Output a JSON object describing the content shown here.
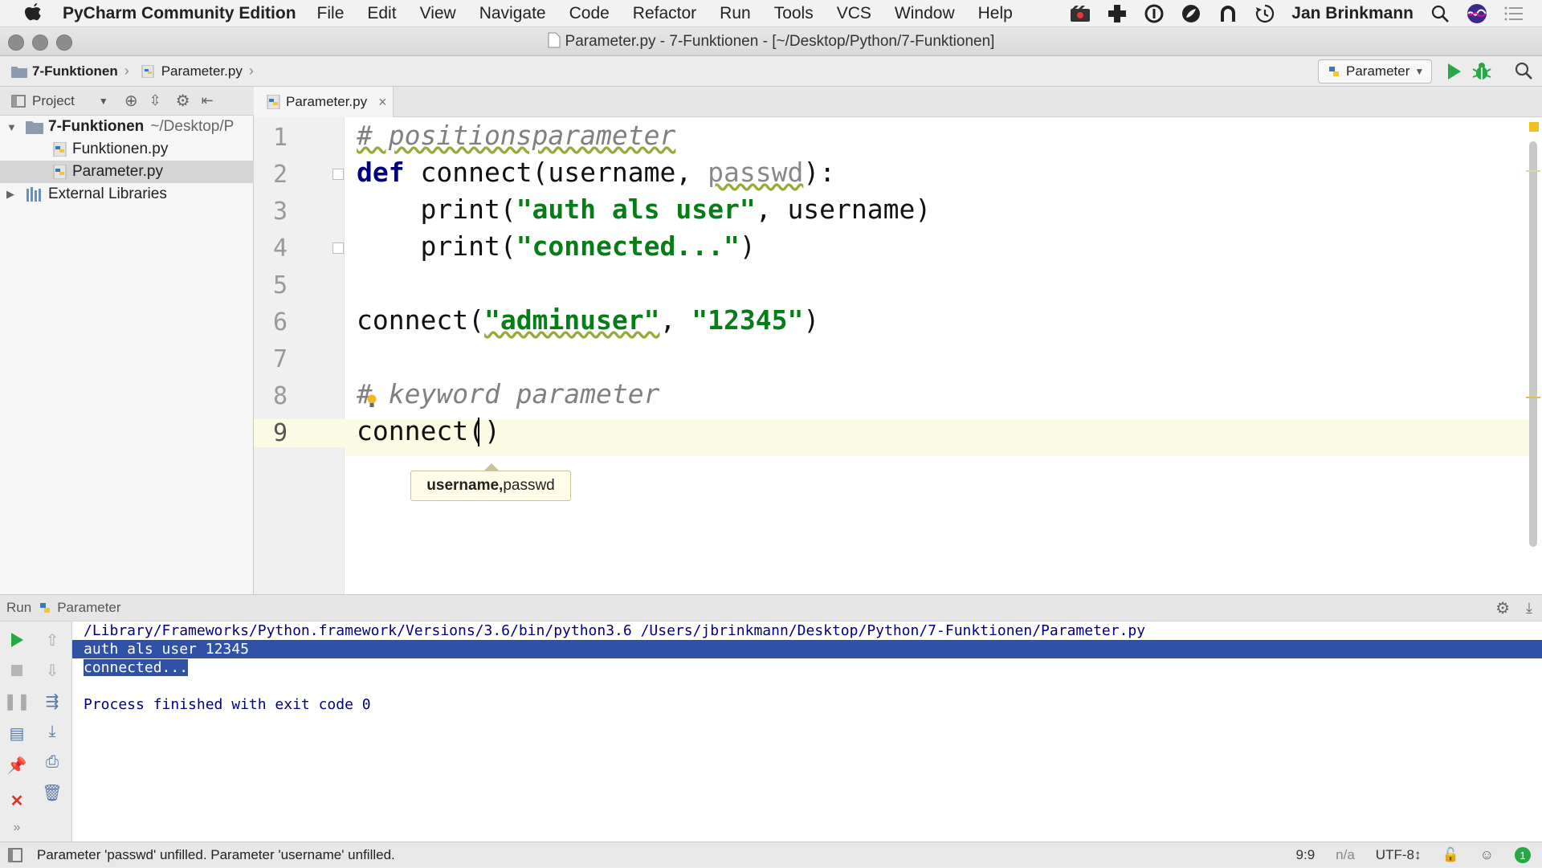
{
  "menubar": {
    "app_name": "PyCharm Community Edition",
    "items": [
      "File",
      "Edit",
      "View",
      "Navigate",
      "Code",
      "Refactor",
      "Run",
      "Tools",
      "VCS",
      "Window",
      "Help"
    ],
    "user": "Jan Brinkmann"
  },
  "window": {
    "title": "Parameter.py - 7-Funktionen - [~/Desktop/Python/7-Funktionen]"
  },
  "navbar": {
    "crumbs": [
      "7-Funktionen",
      "Parameter.py"
    ],
    "run_config": "Parameter"
  },
  "project": {
    "header_label": "Project",
    "root_name": "7-Funktionen",
    "root_path": "~/Desktop/P",
    "files": [
      "Funktionen.py",
      "Parameter.py"
    ],
    "external": "External Libraries"
  },
  "editor": {
    "tab_label": "Parameter.py",
    "line_numbers": [
      "1",
      "2",
      "3",
      "4",
      "5",
      "6",
      "7",
      "8",
      "9"
    ],
    "code": {
      "l1_comment": "# positionsparameter",
      "l2_def": "def",
      "l2_name": " connect(username, ",
      "l2_param": "passwd",
      "l2_end": "):",
      "l3_indent": "    print(",
      "l3_str": "\"auth als user\"",
      "l3_end": ", username)",
      "l4_indent": "    print(",
      "l4_str": "\"connected...\"",
      "l4_end": ")",
      "l6_start": "connect(",
      "l6_str1": "\"adminuser\"",
      "l6_comma": ", ",
      "l6_str2": "\"12345\"",
      "l6_end": ")",
      "l8_hash": "#",
      "l8_comment": " keyword parameter",
      "l9_call": "connect()"
    },
    "tooltip_bold": "username,",
    "tooltip_rest": " passwd"
  },
  "run": {
    "header_label": "Run",
    "config": "Parameter",
    "console": {
      "cmd": "/Library/Frameworks/Python.framework/Versions/3.6/bin/python3.6 /Users/jbrinkmann/Desktop/Python/7-Funktionen/Parameter.py",
      "out1_plain": "auth als user 1",
      "out1_sel": "2345",
      "out2_sel": "connected...",
      "finish": "Process finished with exit code 0"
    }
  },
  "status": {
    "message": "Parameter 'passwd' unfilled. Parameter 'username' unfilled.",
    "position": "9:9",
    "na": "n/a",
    "encoding": "UTF-8↕"
  },
  "colors": {
    "keyword": "#000080",
    "string": "#067d17",
    "comment": "#808080",
    "selection": "#2f52a6",
    "run_green": "#27a844"
  }
}
